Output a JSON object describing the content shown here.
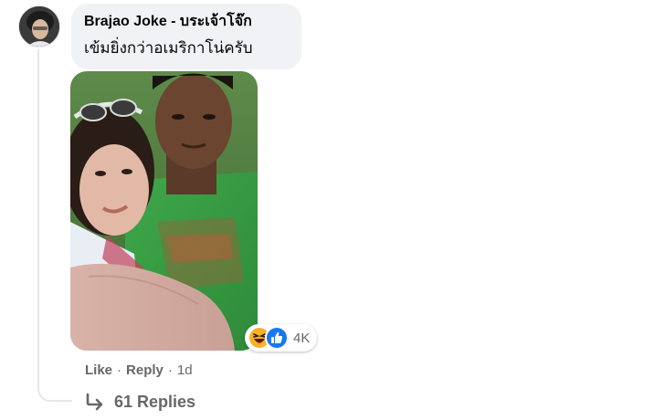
{
  "comment": {
    "author": "Brajao Joke - บระเจ้าโจ๊ก",
    "text": "เข้มยิ่งกว่าอเมริกาโน่ครับ"
  },
  "reactions": {
    "icons": [
      "haha-icon",
      "like-icon"
    ],
    "count": "4K"
  },
  "actions": {
    "like_label": "Like",
    "separator": "·",
    "reply_label": "Reply",
    "timestamp": "1d"
  },
  "replies": {
    "label": "61 Replies"
  },
  "colors": {
    "bubble_bg": "#f0f2f5",
    "text_primary": "#050505",
    "text_secondary": "#65676b",
    "thread_line": "#e4e6eb",
    "like_blue": "#1877f2",
    "haha_yellow": "#f7b125"
  }
}
